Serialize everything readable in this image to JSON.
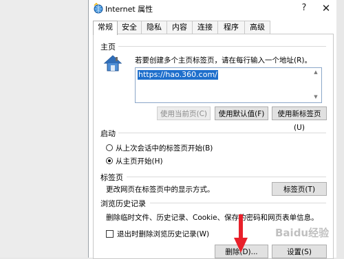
{
  "window": {
    "title": "Internet 属性",
    "help_label": "?",
    "close_label": "✕",
    "icon": "internet-options-icon"
  },
  "tabs": [
    {
      "label": "常规",
      "active": true
    },
    {
      "label": "安全",
      "active": false
    },
    {
      "label": "隐私",
      "active": false
    },
    {
      "label": "内容",
      "active": false
    },
    {
      "label": "连接",
      "active": false
    },
    {
      "label": "程序",
      "active": false
    },
    {
      "label": "高级",
      "active": false
    }
  ],
  "homepage": {
    "section_title": "主页",
    "description": "若要创建多个主页标签页，请在每行输入一个地址(R)。",
    "url_value": "https://hao.360.com/",
    "buttons": {
      "use_current": "使用当前页(C)",
      "use_default": "使用默认值(F)",
      "use_new_tab": "使用新标签页(U)"
    },
    "icon": "house-icon"
  },
  "startup": {
    "section_title": "启动",
    "option_last_session": "从上次会话中的标签页开始(B)",
    "option_homepage": "从主页开始(H)",
    "selected": "option_homepage"
  },
  "tabs_section": {
    "section_title": "标签页",
    "description": "更改网页在标签页中的显示方式。",
    "button": "标签页(T)"
  },
  "history": {
    "section_title": "浏览历史记录",
    "description": "删除临时文件、历史记录、Cookie、保存的密码和网页表单信息。",
    "checkbox_label": "退出时删除浏览历史记录(W)",
    "checkbox_checked": false,
    "delete_button": "删除(D)...",
    "settings_button": "设置(S)"
  },
  "colors": {
    "accent": "#1e6fcc",
    "annotation_arrow": "#e8202a"
  },
  "watermark": "Baidu经验"
}
